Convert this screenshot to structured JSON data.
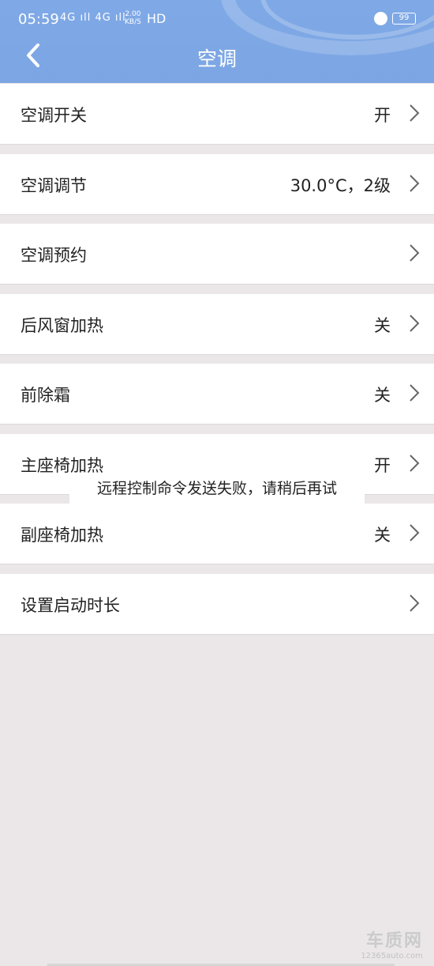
{
  "status_bar": {
    "time": "05:59",
    "signal": "4G ıll 4G ıll",
    "speed_value": "2.00",
    "speed_unit": "KB/S",
    "hd": "HD",
    "battery": "99"
  },
  "header": {
    "title": "空调"
  },
  "rows": [
    {
      "label": "空调开关",
      "value": "开"
    },
    {
      "label": "空调调节",
      "value": "30.0°C，2级"
    },
    {
      "label": "空调预约",
      "value": ""
    },
    {
      "label": "后风窗加热",
      "value": "关"
    },
    {
      "label": "前除霜",
      "value": "关"
    },
    {
      "label": "主座椅加热",
      "value": "开"
    },
    {
      "label": "副座椅加热",
      "value": "关"
    },
    {
      "label": "设置启动时长",
      "value": ""
    }
  ],
  "toast": {
    "message": "远程控制命令发送失败，请稍后再试"
  },
  "watermark": {
    "text": "车质网",
    "url": "12365auto.com"
  },
  "colors": {
    "header_bg": "#7ca6e3",
    "page_bg": "#ebe7e8",
    "row_bg": "#ffffff"
  }
}
